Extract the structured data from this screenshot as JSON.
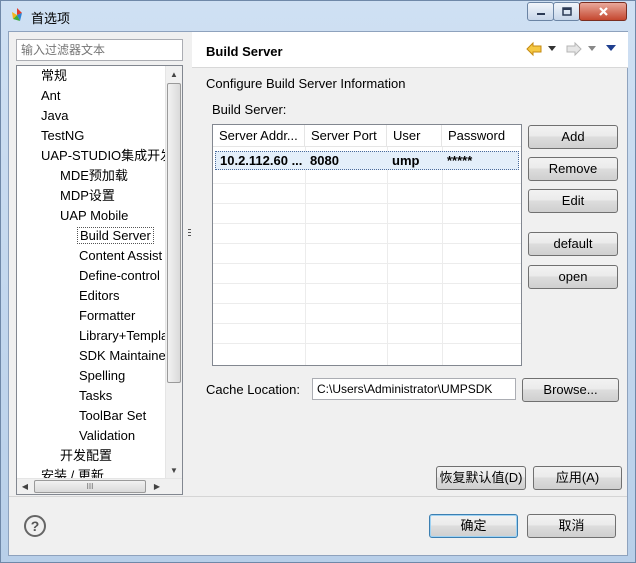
{
  "window": {
    "title": "首选项"
  },
  "filter": {
    "placeholder": "输入过滤器文本"
  },
  "tree": {
    "items": [
      {
        "label": "常规"
      },
      {
        "label": "Ant"
      },
      {
        "label": "Java"
      },
      {
        "label": "TestNG"
      },
      {
        "label": "UAP-STUDIO集成开发环境"
      },
      {
        "label": "MDE预加载"
      },
      {
        "label": "MDP设置"
      },
      {
        "label": "UAP Mobile"
      },
      {
        "label": "Build Server"
      },
      {
        "label": "Content Assist"
      },
      {
        "label": "Define-control"
      },
      {
        "label": "Editors"
      },
      {
        "label": "Formatter"
      },
      {
        "label": "Library+Template"
      },
      {
        "label": "SDK Maintainence"
      },
      {
        "label": "Spelling"
      },
      {
        "label": "Tasks"
      },
      {
        "label": "ToolBar Set"
      },
      {
        "label": "Validation"
      },
      {
        "label": "开发配置"
      },
      {
        "label": "安装 / 更新"
      }
    ],
    "hscroll_grip": "III"
  },
  "page": {
    "title": "Build Server",
    "description": "Configure Build Server Information",
    "group_label": "Build Server:"
  },
  "table": {
    "columns": [
      "Server Addr...",
      "Server Port",
      "User",
      "Password"
    ],
    "rows": [
      {
        "address": "10.2.112.60 ...",
        "port": "8080",
        "user": "ump",
        "password": "*****"
      }
    ]
  },
  "buttons": {
    "add": "Add",
    "remove": "Remove",
    "edit": "Edit",
    "default": "default",
    "open": "open",
    "browse": "Browse...",
    "restore_defaults": "恢复默认值(D)",
    "apply": "应用(A)",
    "ok": "确定",
    "cancel": "取消"
  },
  "cache": {
    "label": "Cache Location:",
    "value": "C:\\Users\\Administrator\\UMPSDK"
  },
  "icons": {
    "back": "back-arrow-icon",
    "forward": "forward-arrow-icon",
    "menu": "view-menu-icon",
    "help": "help-icon"
  },
  "colors": {
    "selection": "#e4effa",
    "back_arrow": "#e8a817",
    "forward_arrow": "#c9c9c9",
    "primary_button_border": "#3c7fb1"
  }
}
